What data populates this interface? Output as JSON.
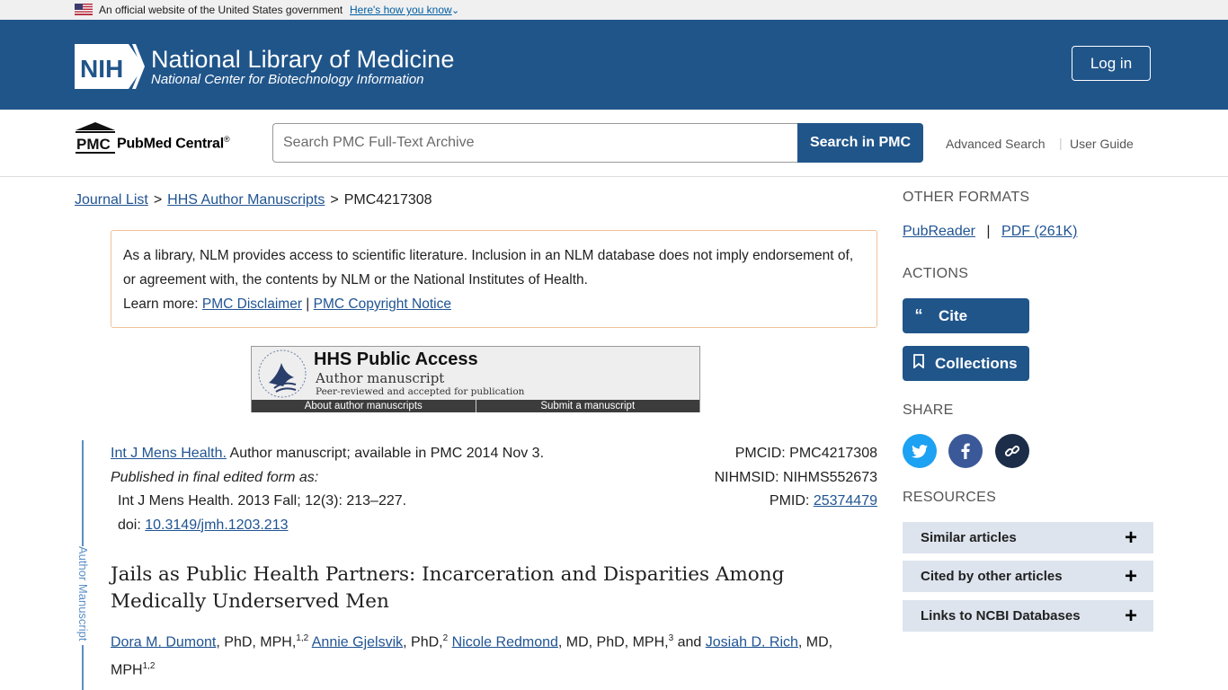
{
  "gov_banner": {
    "text": "An official website of the United States government",
    "link": "Here's how you know"
  },
  "header": {
    "logo_text": "NIH",
    "title": "National Library of Medicine",
    "subtitle": "National Center for Biotechnology Information",
    "login_label": "Log in"
  },
  "pmc_bar": {
    "logo_text": "PMC",
    "name": "PubMed Central",
    "trademark": "®",
    "search_placeholder": "Search PMC Full-Text Archive",
    "search_button": "Search in PMC",
    "advanced_search": "Advanced Search",
    "separator": "|",
    "user_guide": "User Guide"
  },
  "breadcrumb": {
    "items": [
      "Journal List",
      "HHS Author Manuscripts"
    ],
    "current": "PMC4217308",
    "separator": ">"
  },
  "disclaimer": {
    "text": "As a library, NLM provides access to scientific literature. Inclusion in an NLM database does not imply endorsement of, or agreement with, the contents by NLM or the National Institutes of Health.",
    "learn_more": "Learn more:",
    "link1": "PMC Disclaimer",
    "divider": "|",
    "link2": "PMC Copyright Notice"
  },
  "hhs_banner": {
    "title": "HHS Public Access",
    "subtitle": "Author manuscript",
    "peer": "Peer-reviewed and accepted for publication",
    "link1": "About author manuscripts",
    "link2": "Submit a manuscript"
  },
  "rail_label": "Author Manuscript",
  "citation": {
    "journal": "Int J Mens Health.",
    "status": "Author manuscript; available in PMC 2014 Nov 3.",
    "published_label": "Published in final edited form as:",
    "source": "Int J Mens Health. 2013 Fall; 12(3): 213–227.",
    "doi_label": "doi:",
    "doi": "10.3149/jmh.1203.213",
    "pmcid": "PMCID: PMC4217308",
    "nihmsid": "NIHMSID: NIHMS552673",
    "pmid_label": "PMID:",
    "pmid": "25374479"
  },
  "article": {
    "title": "Jails as Public Health Partners: Incarceration and Disparities Among Medically Underserved Men",
    "authors": [
      {
        "name": "Dora M. Dumont",
        "degrees": ", PhD, MPH,",
        "aff": "1,2"
      },
      {
        "name": "Annie Gjelsvik",
        "degrees": ", PhD,",
        "aff": "2"
      },
      {
        "name": "Nicole Redmond",
        "degrees": ", MD, PhD, MPH,",
        "aff": "3"
      },
      {
        "name": "Josiah D. Rich",
        "degrees": ", MD, MPH",
        "aff": "1,2"
      }
    ],
    "and_word": "and"
  },
  "sidebar": {
    "other_formats": "OTHER FORMATS",
    "pubreader": "PubReader",
    "format_sep": "|",
    "pdf": "PDF (261K)",
    "actions": "ACTIONS",
    "cite": "Cite",
    "collections": "Collections",
    "share": "SHARE",
    "resources": "RESOURCES",
    "resource_items": [
      "Similar articles",
      "Cited by other articles",
      "Links to NCBI Databases"
    ]
  },
  "colors": {
    "header_blue": "#20558a",
    "link_blue": "#205493",
    "twitter": "#1da1f2",
    "facebook": "#3b5998",
    "permalink": "#1b2d48"
  }
}
